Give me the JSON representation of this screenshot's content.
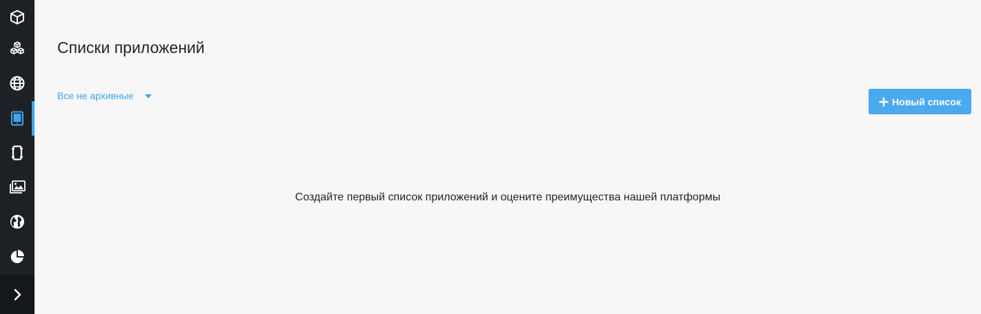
{
  "sidebar": {
    "items": [
      {
        "icon": "cube-icon"
      },
      {
        "icon": "cubes-icon"
      },
      {
        "icon": "globe-icon"
      },
      {
        "icon": "tablet-icon",
        "active": true
      },
      {
        "icon": "notebook-icon"
      },
      {
        "icon": "images-icon"
      },
      {
        "icon": "world-icon"
      },
      {
        "icon": "pie-chart-icon"
      },
      {
        "icon": "chevron-right-icon"
      }
    ],
    "accent_color": "#3fa5ef",
    "background_color": "#1d2126"
  },
  "main": {
    "title": "Списки приложений",
    "filter": {
      "selected": "Все не архивные"
    },
    "new_button": {
      "label": "Новый список"
    },
    "empty_message": "Создайте первый список приложений и оцените преимущества нашей платформы"
  }
}
